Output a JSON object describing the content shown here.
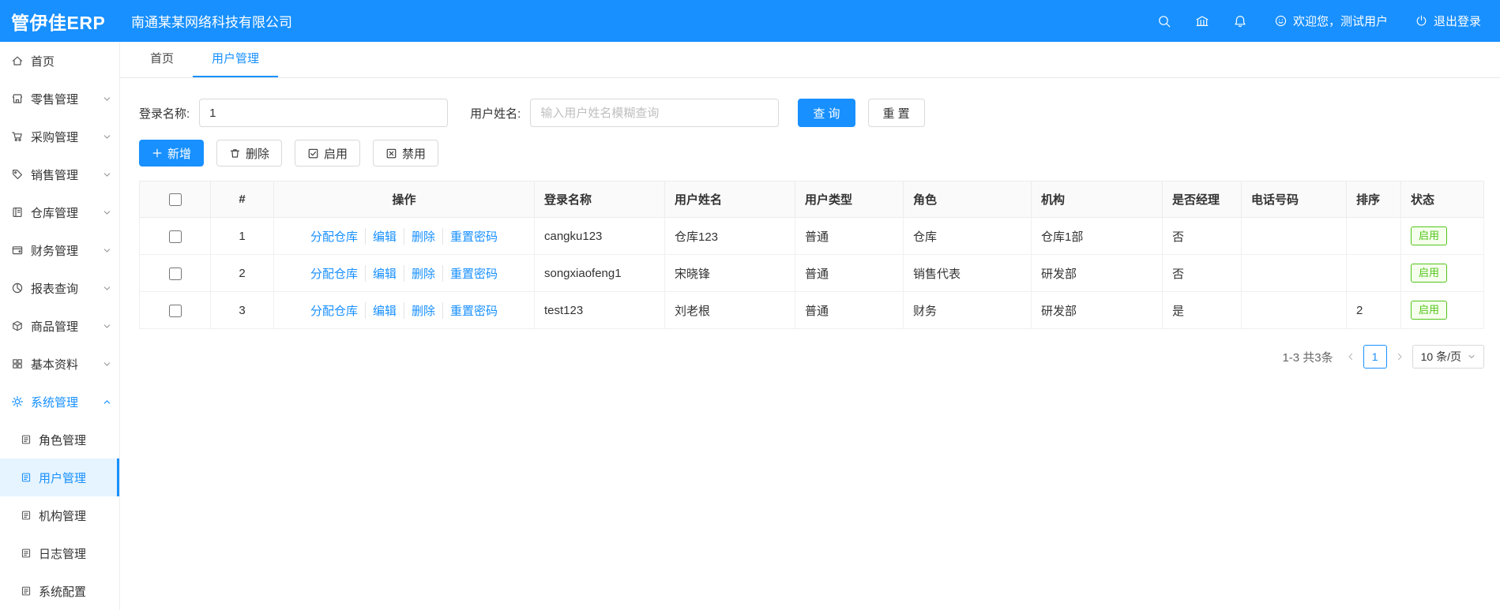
{
  "topbar": {
    "logo": "管伊佳ERP",
    "company": "南通某某网络科技有限公司",
    "welcome": "欢迎您，测试用户",
    "logout": "退出登录"
  },
  "tabs": [
    {
      "label": "首页"
    },
    {
      "label": "用户管理",
      "active": true
    }
  ],
  "sidebar": {
    "items": [
      {
        "label": "首页"
      },
      {
        "label": "零售管理"
      },
      {
        "label": "采购管理"
      },
      {
        "label": "销售管理"
      },
      {
        "label": "仓库管理"
      },
      {
        "label": "财务管理"
      },
      {
        "label": "报表查询"
      },
      {
        "label": "商品管理"
      },
      {
        "label": "基本资料"
      },
      {
        "label": "系统管理",
        "active": true
      }
    ],
    "submenu": [
      {
        "label": "角色管理"
      },
      {
        "label": "用户管理",
        "active": true
      },
      {
        "label": "机构管理"
      },
      {
        "label": "日志管理"
      },
      {
        "label": "系统配置"
      }
    ]
  },
  "filter": {
    "login_name_label": "登录名称:",
    "login_name_value": "1",
    "user_name_label": "用户姓名:",
    "user_name_placeholder": "输入用户姓名模糊查询",
    "search_button": "查 询",
    "reset_button": "重 置"
  },
  "toolbar": {
    "add": "新增",
    "delete": "删除",
    "enable": "启用",
    "disable": "禁用"
  },
  "table": {
    "headers": [
      "#",
      "操作",
      "登录名称",
      "用户姓名",
      "用户类型",
      "角色",
      "机构",
      "是否经理",
      "电话号码",
      "排序",
      "状态"
    ],
    "action_links": [
      "分配仓库",
      "编辑",
      "删除",
      "重置密码"
    ],
    "rows": [
      {
        "index": "1",
        "login": "cangku123",
        "name": "仓库123",
        "type": "普通",
        "role": "仓库",
        "org": "仓库1部",
        "manager": "否",
        "phone": "",
        "sort": "",
        "status": "启用"
      },
      {
        "index": "2",
        "login": "songxiaofeng1",
        "name": "宋晓锋",
        "type": "普通",
        "role": "销售代表",
        "org": "研发部",
        "manager": "否",
        "phone": "",
        "sort": "",
        "status": "启用"
      },
      {
        "index": "3",
        "login": "test123",
        "name": "刘老根",
        "type": "普通",
        "role": "财务",
        "org": "研发部",
        "manager": "是",
        "phone": "",
        "sort": "2",
        "status": "启用"
      }
    ]
  },
  "pagination": {
    "total_text": "1-3 共3条",
    "current_page": "1",
    "page_size": "10 条/页"
  },
  "colors": {
    "primary": "#1890ff",
    "success": "#52c41a"
  }
}
